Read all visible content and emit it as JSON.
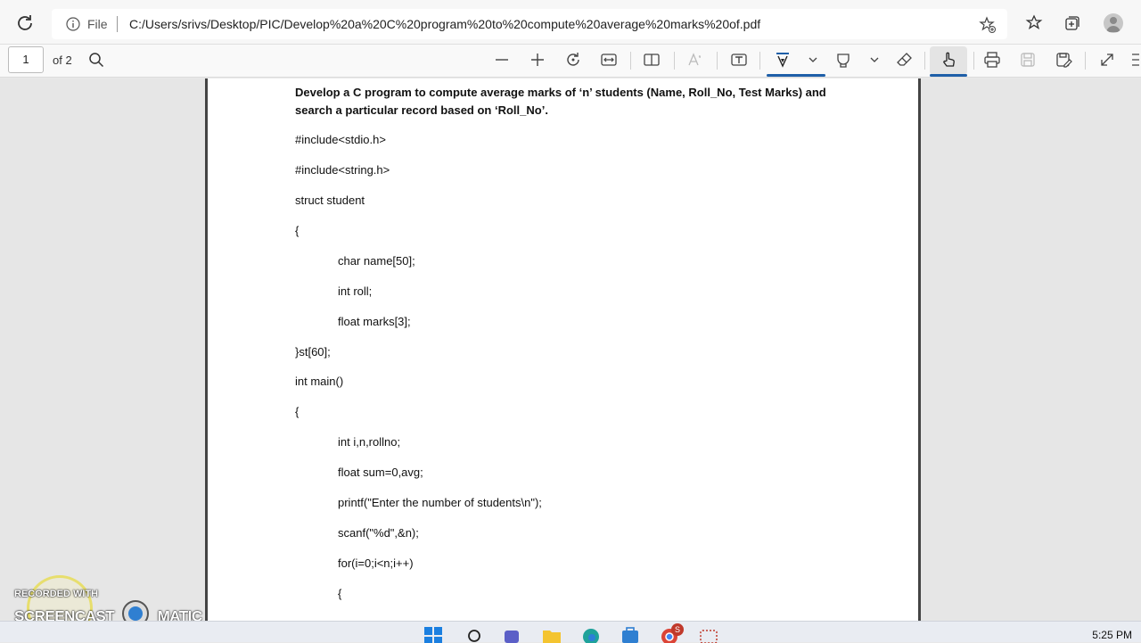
{
  "browser": {
    "file_label": "File",
    "url": "C:/Users/srivs/Desktop/PIC/Develop%20a%20C%20program%20to%20compute%20average%20marks%20of.pdf"
  },
  "pdf_toolbar": {
    "page_number": "1",
    "page_count": "of 2"
  },
  "document": {
    "title_line1": "Develop a C program to compute average marks of  ‘n’ students (Name, Roll_No, Test Marks) and",
    "title_line2": "search a particular record based on  ‘Roll_No’.",
    "code": [
      "#include<stdio.h>",
      "#include<string.h>",
      "struct student",
      "{",
      "char name[50];",
      "int roll;",
      "float marks[3];",
      "}st[60];",
      "int main()",
      "{",
      "int i,n,rollno;",
      "float sum=0,avg;",
      "printf(\"Enter the number of students\\n\");",
      "scanf(\"%d\",&n);",
      "for(i=0;i<n;i++)",
      "{"
    ]
  },
  "watermark": {
    "recorded_with": "RECORDED WITH",
    "brand": "SCREENCAST",
    "brand_suffix": "MATIC"
  },
  "taskbar": {
    "clock": "5:25 PM",
    "badge": "S"
  }
}
